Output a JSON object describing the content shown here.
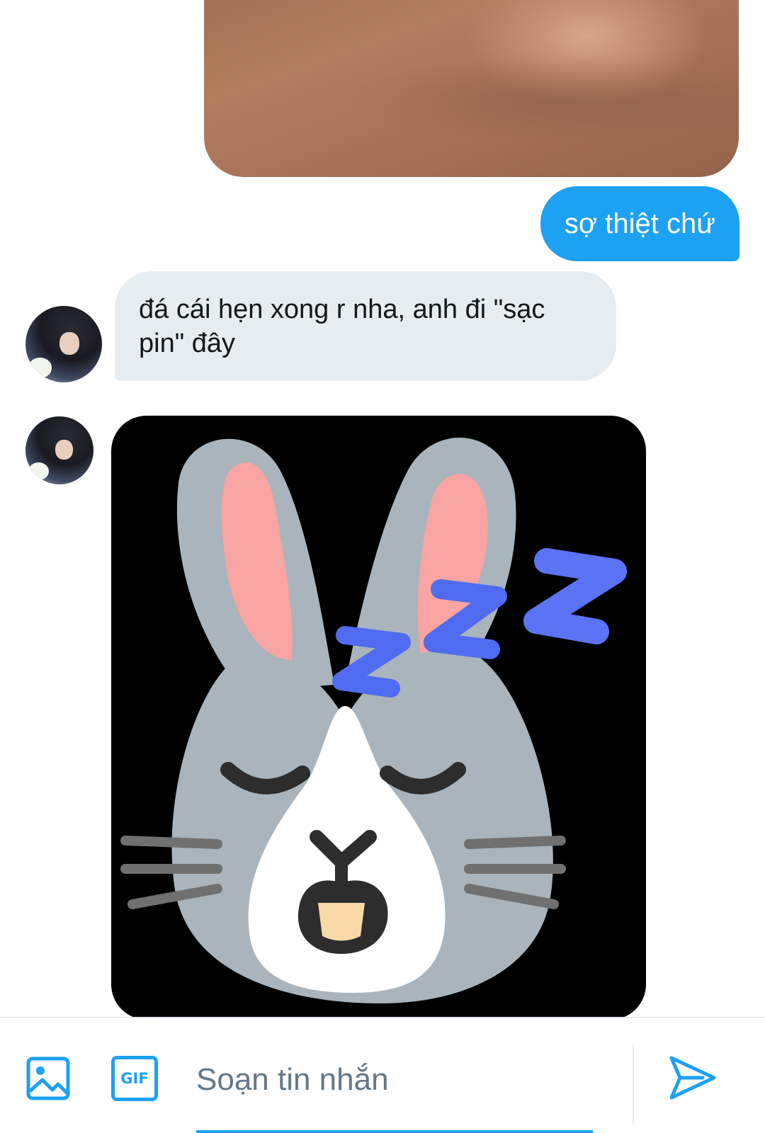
{
  "messages": {
    "outgoing_text": "sợ thiệt chứ",
    "incoming_text": "đá cái hẹn xong r nha, anh đi \"sạc pin\" đây"
  },
  "composer": {
    "placeholder": "Soạn tin nhắn",
    "gif_label": "GIF"
  },
  "colors": {
    "accent": "#1da1f2",
    "incoming_bubble": "#e6ecf0",
    "placeholder_text": "#657786"
  },
  "icons": {
    "image": "image-icon",
    "gif": "gif-icon",
    "send": "send-icon"
  }
}
